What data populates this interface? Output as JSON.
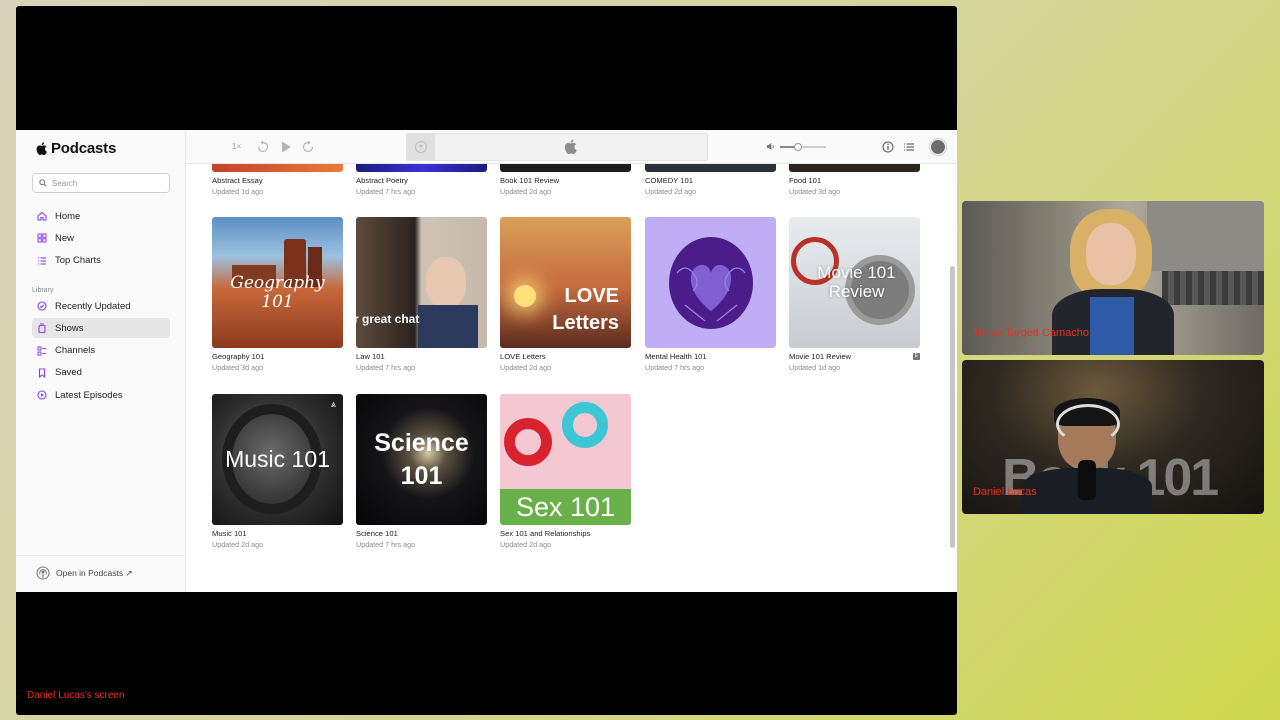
{
  "screen_share": {
    "label": "Daniel Lucas's screen"
  },
  "app": {
    "name": "Podcasts",
    "search_placeholder": "Search",
    "nav": [
      {
        "label": "Home",
        "icon": "home-icon"
      },
      {
        "label": "New",
        "icon": "grid-icon"
      },
      {
        "label": "Top Charts",
        "icon": "list-icon"
      }
    ],
    "library_label": "Library",
    "library": [
      {
        "label": "Recently Updated",
        "icon": "clock-check-icon"
      },
      {
        "label": "Shows",
        "icon": "shows-icon",
        "active": true
      },
      {
        "label": "Channels",
        "icon": "channels-icon"
      },
      {
        "label": "Saved",
        "icon": "bookmark-icon"
      },
      {
        "label": "Latest Episodes",
        "icon": "play-circle-icon"
      }
    ],
    "open_in_podcasts": "Open in Podcasts ↗"
  },
  "player": {
    "speed": "1×",
    "volume_level": 0.4
  },
  "shows_row_top": [
    {
      "title": "Abstract Essay",
      "updated": "Updated 1d ago",
      "color": "#c2432b"
    },
    {
      "title": "Abstract Poetry",
      "updated": "Updated 7 hrs ago",
      "color": "#1e1b7a"
    },
    {
      "title": "Book 101 Review",
      "updated": "Updated 2d ago",
      "color": "#1b1b1b"
    },
    {
      "title": "COMEDY 101",
      "updated": "Updated 2d ago",
      "color": "#2a3236"
    },
    {
      "title": "Food 101",
      "updated": "Updated 3d ago",
      "color": "#2b2520"
    }
  ],
  "shows_row_mid": [
    {
      "title": "Geography 101",
      "updated": "Updated 3d ago",
      "art_text": "Geography 101"
    },
    {
      "title": "Law 101",
      "updated": "Updated 7 hrs ago",
      "art_text": "r great chat"
    },
    {
      "title": "LOVE Letters",
      "updated": "Updated 2d ago",
      "art_text": "LOVE Letters"
    },
    {
      "title": "Mental Health 101",
      "updated": "Updated 7 hrs ago",
      "art_text": ""
    },
    {
      "title": "Movie 101 Review",
      "updated": "Updated 1d ago",
      "art_text": "Movie 101 Review",
      "explicit": "E"
    }
  ],
  "shows_row_bottom": [
    {
      "title": "Music 101",
      "updated": "Updated 2d ago",
      "art_text": "Music 101"
    },
    {
      "title": "Science 101",
      "updated": "Updated 7 hrs ago",
      "art_text": "Science 101"
    },
    {
      "title": "Sex 101 and Relationships",
      "updated": "Updated 2d ago",
      "art_text": "Sex 101"
    }
  ],
  "participants": [
    {
      "name": "Tanya Targett Camacho"
    },
    {
      "name": "Daniel Lucas",
      "backdrop_text": "Book 101"
    }
  ]
}
